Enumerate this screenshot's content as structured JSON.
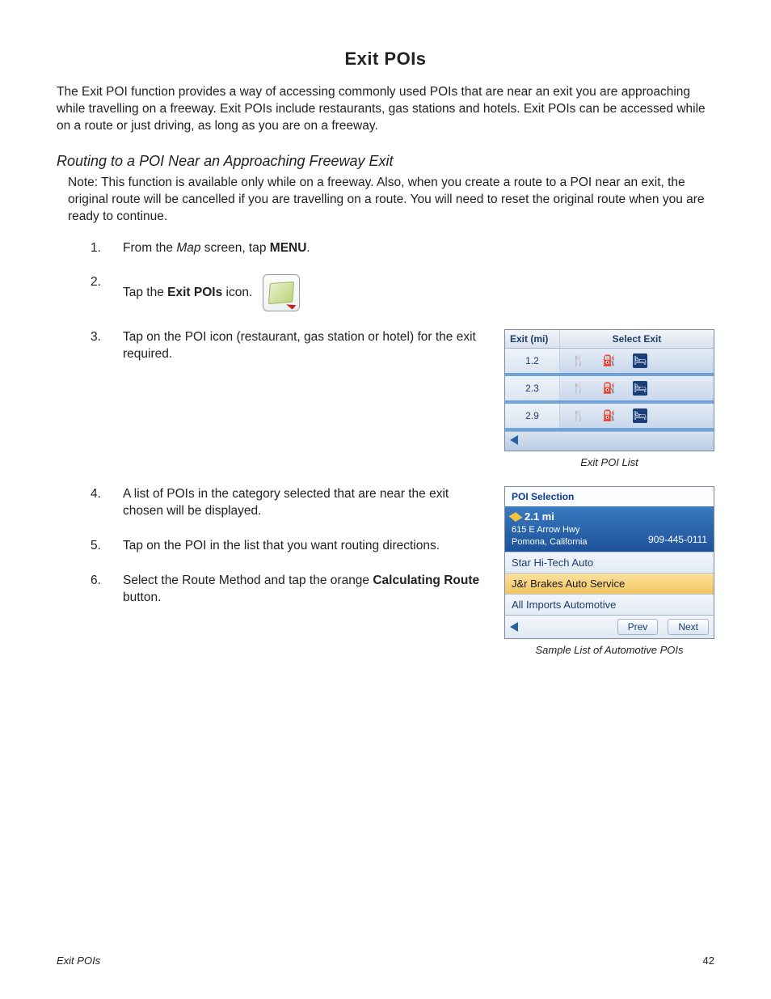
{
  "title": "Exit POIs",
  "intro": "The Exit POI function provides a way of accessing commonly used POIs that are near an exit you are approaching while travelling on a freeway.  Exit POIs include restaurants, gas stations and hotels.  Exit POIs can be accessed while on a route or just driving, as long as you are on a freeway.",
  "subheading": "Routing to a POI Near an Approaching Freeway Exit",
  "note": "Note: This function is available only while on a freeway.  Also, when you create a route to a POI near an exit, the original route will be cancelled if you are travelling on a route.  You will need to reset the original route when you are ready to continue.",
  "steps": {
    "s1_pre": "From the ",
    "s1_map": "Map",
    "s1_mid": " screen, tap ",
    "s1_menu": "MENU",
    "s1_post": ".",
    "s2_pre": "Tap the ",
    "s2_label": "Exit POIs",
    "s2_post": " icon.",
    "s3": "Tap on the POI icon (restaurant, gas station or hotel) for the exit required.",
    "s4": "A list of POIs in the category selected that are near the exit chosen will be displayed.",
    "s5": "Tap on the POI in the list that you want routing directions.",
    "s6_pre": "Select the Route Method and tap the orange ",
    "s6_btn": "Calculating Route",
    "s6_post": " button."
  },
  "nums": {
    "n1": "1.",
    "n2": "2.",
    "n3": "3.",
    "n4": "4.",
    "n5": "5.",
    "n6": "6."
  },
  "exitList": {
    "header_left": "Exit (mi)",
    "header_right": "Select Exit",
    "rows": [
      "1.2",
      "2.3",
      "2.9"
    ],
    "caption": "Exit POI List"
  },
  "poiSel": {
    "title": "POI Selection",
    "distance": "2.1 mi",
    "addr1": "615 E Arrow Hwy",
    "addr2": "Pomona, California",
    "phone": "909-445-0111",
    "item1": "Star Hi-Tech Auto",
    "item2": "J&r Brakes Auto Service",
    "item3": "All Imports Automotive",
    "prev": "Prev",
    "next": "Next",
    "caption": "Sample List of Automotive POIs"
  },
  "footer": {
    "left": "Exit POIs",
    "right": "42"
  }
}
